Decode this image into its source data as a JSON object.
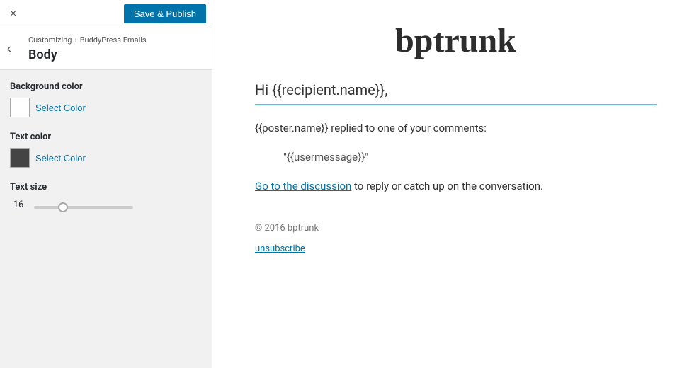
{
  "topBar": {
    "closeIcon": "×",
    "savePublishLabel": "Save & Publish"
  },
  "breadcrumb": {
    "backIcon": "‹",
    "root": "Customizing",
    "separator": "›",
    "child": "BuddyPress Emails",
    "pageTitle": "Body"
  },
  "controls": {
    "bgColor": {
      "label": "Background color",
      "swatchColor": "white",
      "buttonLabel": "Select Color"
    },
    "textColor": {
      "label": "Text color",
      "swatchColor": "dark",
      "buttonLabel": "Select Color"
    },
    "textSize": {
      "label": "Text size",
      "value": "16",
      "min": "10",
      "max": "32",
      "step": "1",
      "current": 16
    }
  },
  "emailPreview": {
    "logo": "bptrunk",
    "greeting": "Hi {{recipient.name}},",
    "bodyText": "{{poster.name}} replied to one of your comments:",
    "quote": "\"{{usermessage}}\"",
    "ctaLinkText": "Go to the discussion",
    "ctaRest": " to reply or catch up on the conversation.",
    "footer": "© 2016 bptrunk",
    "unsubscribe": "unsubscribe"
  }
}
